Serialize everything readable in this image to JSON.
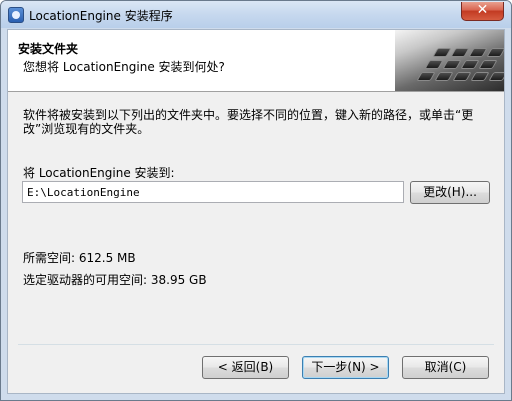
{
  "window": {
    "title": "LocationEngine 安装程序",
    "close_glyph": "✕"
  },
  "header": {
    "title": "安装文件夹",
    "subtitle": "您想将 LocationEngine 安装到何处?"
  },
  "description": "软件将被安装到以下列出的文件夹中。要选择不同的位置，键入新的路径，或单击“更改”浏览现有的文件夹。",
  "install": {
    "label": "将 LocationEngine 安装到:",
    "path": "E:\\LocationEngine",
    "change_button": "更改(H)..."
  },
  "space": {
    "required": "所需空间:  612.5 MB",
    "available": "选定驱动器的可用空间:  38.95 GB"
  },
  "buttons": {
    "back": "< 返回(B)",
    "next": "下一步(N) >",
    "cancel": "取消(C)"
  },
  "colors": {
    "close": "#c8412a",
    "default_button_border": "#3c7fb1"
  },
  "icons": {
    "app": "installer-icon",
    "header_image": "keyboard-image"
  }
}
